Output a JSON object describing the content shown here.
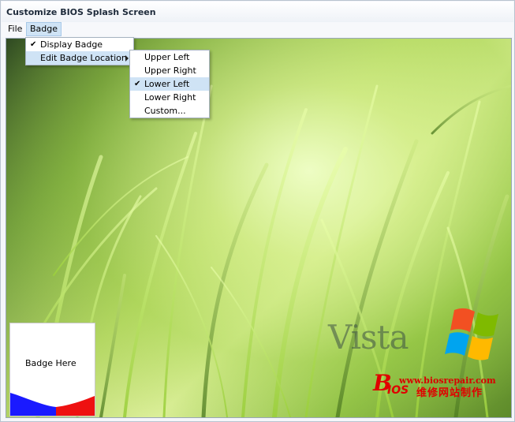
{
  "window": {
    "title": "Customize BIOS Splash Screen"
  },
  "menubar": {
    "file": "File",
    "badge": "Badge"
  },
  "badge_menu": {
    "display_badge": {
      "label": "Display Badge",
      "checked": true
    },
    "edit_badge_location": {
      "label": "Edit Badge Location"
    }
  },
  "location_menu": {
    "items": [
      {
        "label": "Upper Left",
        "checked": false
      },
      {
        "label": "Upper Right",
        "checked": false
      },
      {
        "label": "Lower Left",
        "checked": true
      },
      {
        "label": "Lower Right",
        "checked": false
      },
      {
        "label": "Custom...",
        "checked": false
      }
    ]
  },
  "canvas": {
    "badge_text": "Badge Here",
    "logo_text": "Vista",
    "watermark_url": "www.biosrepair.com",
    "watermark_b": "B",
    "watermark_ios": "IOS",
    "watermark_cn": "维修网站制作"
  },
  "colors": {
    "menu_highlight": "#cfe3f5",
    "badge_blue": "#1a1aff",
    "badge_red": "#ee1111",
    "watermark": "#d90000"
  }
}
